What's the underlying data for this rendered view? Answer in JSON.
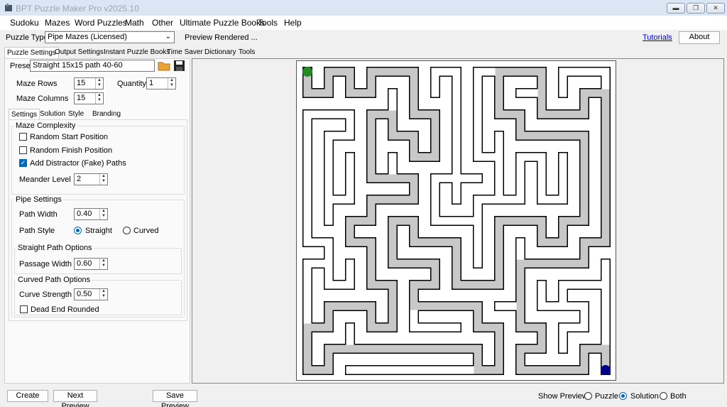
{
  "window": {
    "title": "BPT Puzzle Maker Pro v2025.10"
  },
  "menu": [
    "Sudoku",
    "Mazes",
    "Word Puzzles",
    "Math",
    "Other",
    "Ultimate Puzzle Books",
    "Tools",
    "Help"
  ],
  "toolbar": {
    "puzzle_type_label": "Puzzle Type",
    "puzzle_type_value": "Pipe Mazes (Licensed)",
    "status": "Preview Rendered ...",
    "tutorials": "Tutorials",
    "about": "About"
  },
  "tabs": [
    "Puzzle Settings",
    "Output Settings",
    "Instant Puzzle Books",
    "Time Saver",
    "Dictionary",
    "Tools"
  ],
  "preset": {
    "label": "Preset",
    "value": "Straight 15x15 path 40-60"
  },
  "maze": {
    "rows_label": "Maze Rows",
    "rows": "15",
    "cols_label": "Maze Columns",
    "cols": "15",
    "quantity_label": "Quantity",
    "quantity": "1"
  },
  "subtabs": [
    "Settings",
    "Solution",
    "Style",
    "Branding"
  ],
  "complexity": {
    "title": "Maze Complexity",
    "random_start": "Random Start Position",
    "random_finish": "Random Finish Position",
    "distractor": "Add Distractor (Fake) Paths",
    "meander_label": "Meander Level",
    "meander": "2"
  },
  "pipe": {
    "title": "Pipe Settings",
    "path_width_label": "Path Width",
    "path_width": "0.40",
    "path_style_label": "Path Style",
    "straight": "Straight",
    "curved": "Curved"
  },
  "straight_opts": {
    "title": "Straight Path Options",
    "passage_label": "Passage Width",
    "passage": "0.60"
  },
  "curved_opts": {
    "title": "Curved Path Options",
    "curve_label": "Curve Strength",
    "curve": "0.50",
    "dead_end": "Dead End Rounded"
  },
  "bottom": {
    "create": "Create",
    "next": "Next Preview",
    "save": "Save Preview",
    "show_label": "Show Preview:",
    "puzzle": "Puzzle",
    "solution": "Solution",
    "both": "Both"
  },
  "colors": {
    "start": "#228b22",
    "finish": "#00008b",
    "solution": "#c8c8c8",
    "accent": "#0067c0"
  }
}
